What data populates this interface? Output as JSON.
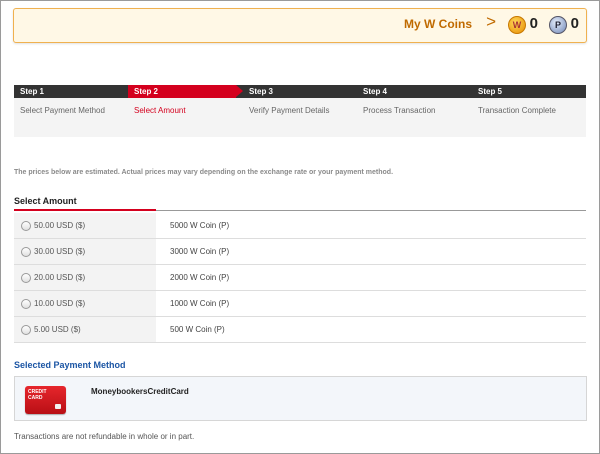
{
  "coins": {
    "title": "My W Coins",
    "arrow": ">",
    "w_icon": "W",
    "w_value": "0",
    "p_icon": "P",
    "p_value": "0"
  },
  "steps": [
    {
      "title": "Step 1",
      "label": "Select Payment Method"
    },
    {
      "title": "Step 2",
      "label": "Select Amount"
    },
    {
      "title": "Step 3",
      "label": "Verify Payment Details"
    },
    {
      "title": "Step 4",
      "label": "Process Transaction"
    },
    {
      "title": "Step 5",
      "label": "Transaction Complete"
    }
  ],
  "active_step": 2,
  "notice": "The prices below are estimated. Actual prices may vary depending on the exchange rate or your payment method.",
  "amount_section": {
    "title": "Select Amount",
    "options": [
      {
        "price": "50.00 USD ($)",
        "coin": "5000 W Coin (P)"
      },
      {
        "price": "30.00 USD ($)",
        "coin": "3000 W Coin (P)"
      },
      {
        "price": "20.00 USD ($)",
        "coin": "2000 W Coin (P)"
      },
      {
        "price": "10.00 USD ($)",
        "coin": "1000 W Coin (P)"
      },
      {
        "price": "5.00 USD ($)",
        "coin": "500 W Coin (P)"
      }
    ]
  },
  "payment": {
    "title": "Selected Payment Method",
    "card_text": "CREDIT CARD",
    "method": "MoneybookersCreditCard"
  },
  "footer": {
    "refund_note": "Transactions are not refundable in whole or in part."
  },
  "colors": {
    "accent_red": "#d4001e",
    "coin_orange": "#c06a00",
    "link_blue": "#1b55a4"
  }
}
